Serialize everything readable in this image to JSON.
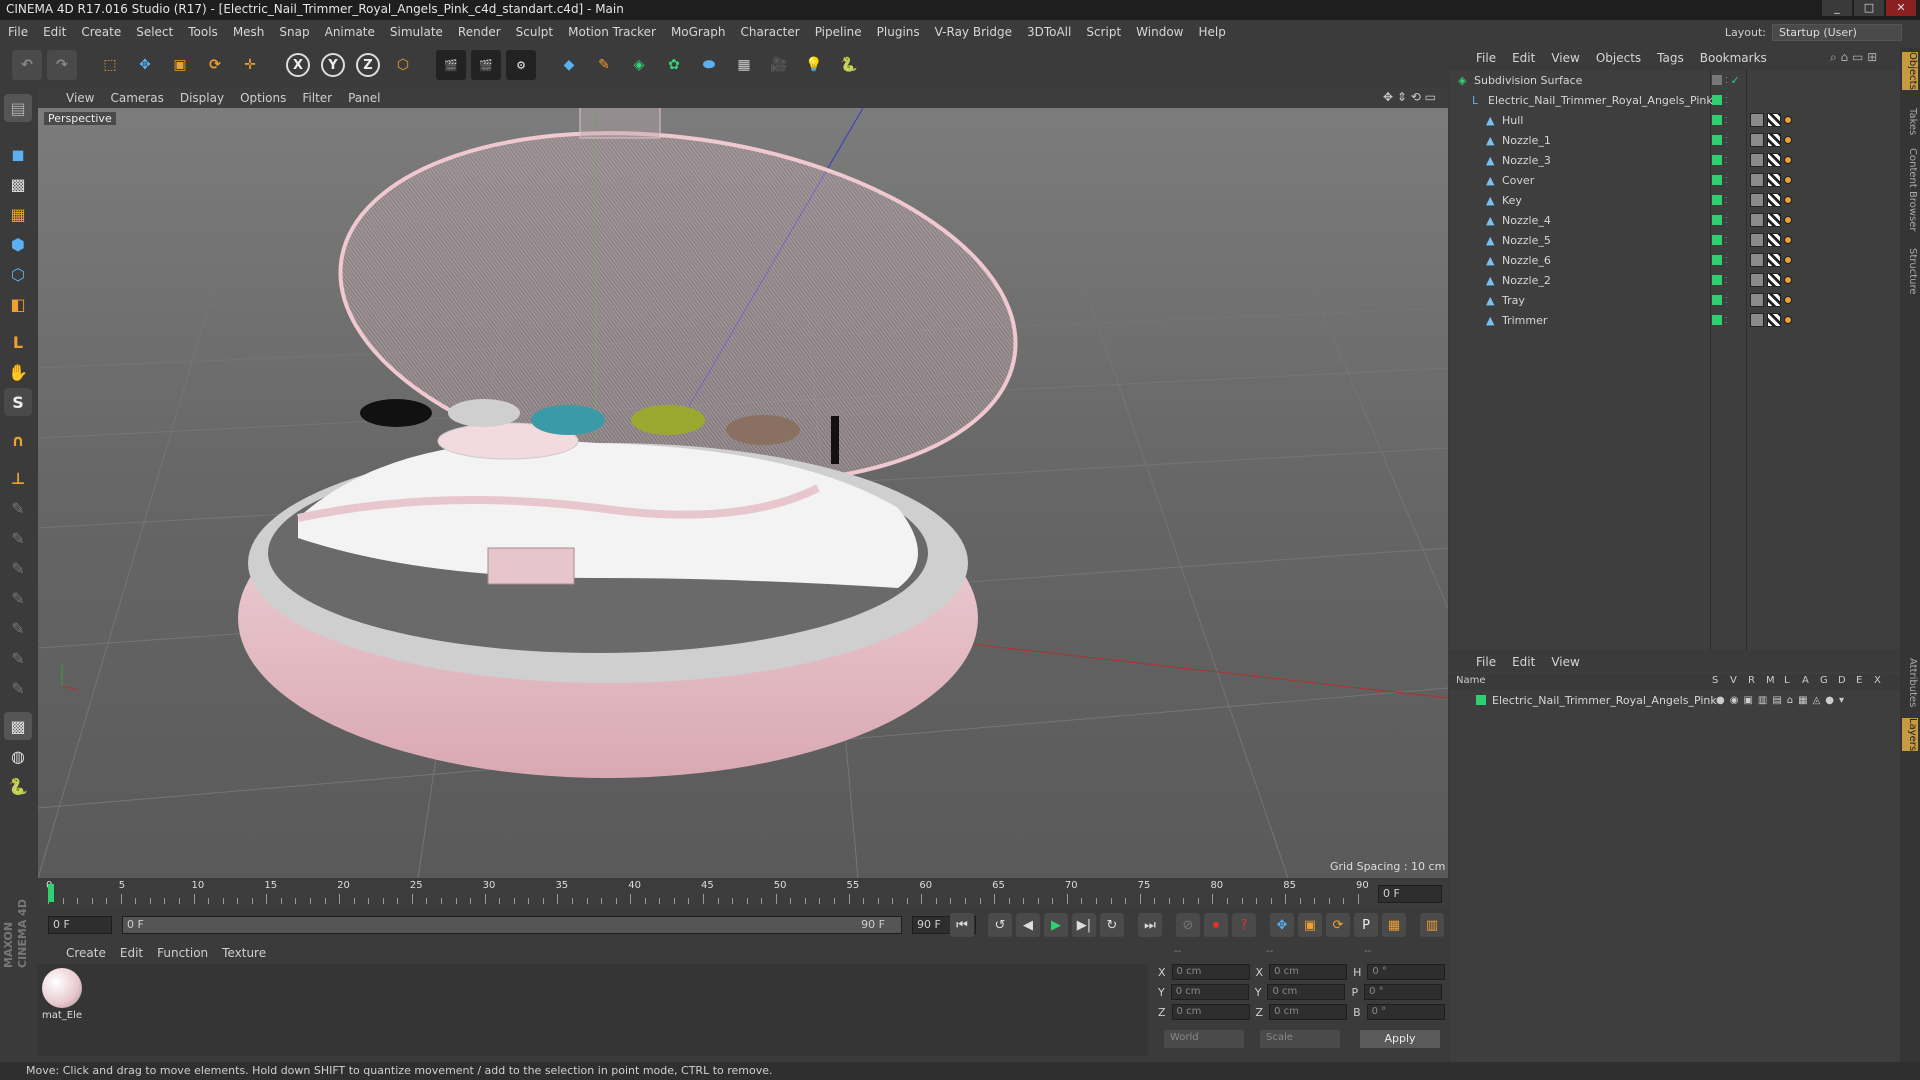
{
  "title_bar": {
    "text": "CINEMA 4D R17.016 Studio (R17) - [Electric_Nail_Trimmer_Royal_Angels_Pink_c4d_standart.c4d] - Main"
  },
  "menu": [
    "File",
    "Edit",
    "Create",
    "Select",
    "Tools",
    "Mesh",
    "Snap",
    "Animate",
    "Simulate",
    "Render",
    "Sculpt",
    "Motion Tracker",
    "MoGraph",
    "Character",
    "Pipeline",
    "Plugins",
    "V-Ray Bridge",
    "3DToAll",
    "Script",
    "Window",
    "Help"
  ],
  "layout": {
    "label": "Layout:",
    "value": "Startup (User)"
  },
  "toolbar": {
    "x_label": "X",
    "y_label": "Y",
    "z_label": "Z"
  },
  "viewport": {
    "menu": [
      "View",
      "Cameras",
      "Display",
      "Options",
      "Filter",
      "Panel"
    ],
    "camera_label": "Perspective",
    "grid_spacing": "Grid Spacing : 10 cm"
  },
  "timeline": {
    "ticks": [
      "0",
      "5",
      "10",
      "15",
      "20",
      "25",
      "30",
      "35",
      "40",
      "45",
      "50",
      "55",
      "60",
      "65",
      "70",
      "75",
      "80",
      "85",
      "90"
    ],
    "current_frame": "0 F",
    "start_field": "0 F",
    "range_start": "0 F",
    "range_end": "90 F",
    "end_field": "90 F"
  },
  "material_manager": {
    "menu": [
      "Create",
      "Edit",
      "Function",
      "Texture"
    ],
    "materials": [
      {
        "name": "mat_Ele"
      }
    ]
  },
  "coordinates": {
    "headers": [
      "--",
      "--",
      "--"
    ],
    "rows": [
      {
        "a": "X",
        "av": "0 cm",
        "b": "X",
        "bv": "0 cm",
        "c": "H",
        "cv": "0 °"
      },
      {
        "a": "Y",
        "av": "0 cm",
        "b": "Y",
        "bv": "0 cm",
        "c": "P",
        "cv": "0 °"
      },
      {
        "a": "Z",
        "av": "0 cm",
        "b": "Z",
        "bv": "0 cm",
        "c": "B",
        "cv": "0 °"
      }
    ],
    "mode": "World",
    "scale": "Scale",
    "apply": "Apply"
  },
  "object_manager": {
    "menu": [
      "File",
      "Edit",
      "View",
      "Objects",
      "Tags",
      "Bookmarks"
    ],
    "objects": [
      {
        "name": "Subdivision Surface",
        "level": 0
      },
      {
        "name": "Electric_Nail_Trimmer_Royal_Angels_Pink",
        "level": 1
      },
      {
        "name": "Hull",
        "level": 2
      },
      {
        "name": "Nozzle_1",
        "level": 2
      },
      {
        "name": "Nozzle_3",
        "level": 2
      },
      {
        "name": "Cover",
        "level": 2
      },
      {
        "name": "Key",
        "level": 2
      },
      {
        "name": "Nozzle_4",
        "level": 2
      },
      {
        "name": "Nozzle_5",
        "level": 2
      },
      {
        "name": "Nozzle_6",
        "level": 2
      },
      {
        "name": "Nozzle_2",
        "level": 2
      },
      {
        "name": "Tray",
        "level": 2
      },
      {
        "name": "Trimmer",
        "level": 2
      }
    ]
  },
  "layer_manager": {
    "menu": [
      "File",
      "Edit",
      "View"
    ],
    "columns": [
      "Name",
      "S",
      "V",
      "R",
      "M",
      "L",
      "A",
      "G",
      "D",
      "E",
      "X"
    ],
    "layers": [
      {
        "name": "Electric_Nail_Trimmer_Royal_Angels_Pink",
        "color": "#2fd070"
      }
    ]
  },
  "side_tabs": [
    "Objects",
    "Takes",
    "Content Browser",
    "Structure",
    "Attributes",
    "Layers"
  ],
  "status_bar": {
    "text": "Move: Click and drag to move elements. Hold down SHIFT to quantize movement / add to the selection in point mode, CTRL to remove."
  },
  "branding": {
    "text": "MAXON CINEMA 4D"
  }
}
